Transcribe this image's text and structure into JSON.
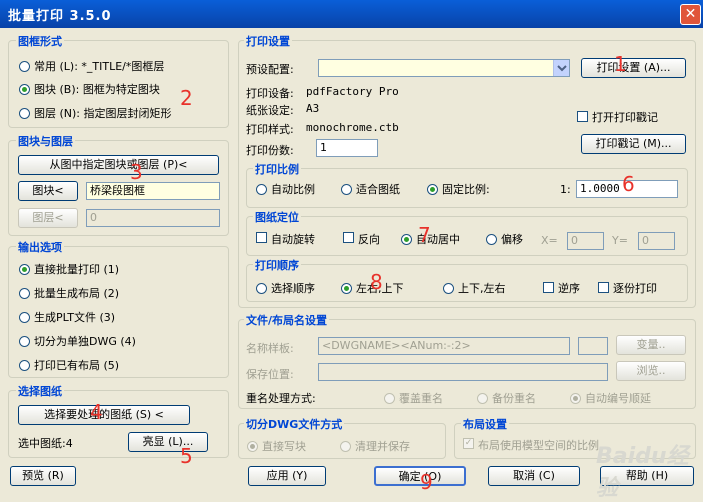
{
  "window": {
    "title": "批量打印 3.5.0",
    "close": "✕"
  },
  "frame_style": {
    "title": "图框形式",
    "options": [
      "常用 (L): *_TITLE/*图框层",
      "图块 (B): 图框为特定图块",
      "图层 (N): 指定图层封闭矩形"
    ],
    "selected": 1
  },
  "block_layer": {
    "title": "图块与图层",
    "pick_button": "从图中指定图块或图层 (P)<",
    "block_button": "图块<",
    "block_value": "桥梁段图框",
    "layer_button": "图层<",
    "layer_value": "0"
  },
  "output": {
    "title": "输出选项",
    "options": [
      "直接批量打印 (1)",
      "批量生成布局 (2)",
      "生成PLT文件 (3)",
      "切分为单独DWG (4)",
      "打印已有布局 (5)"
    ],
    "selected": 0
  },
  "select": {
    "title": "选择图纸",
    "select_button": "选择要处理的图纸 (S) <",
    "count_label": "选中图纸:4",
    "highlight_button": "亮显 (L)..."
  },
  "preview_button": "预览 (R)",
  "print_settings": {
    "title": "打印设置",
    "preset_label": "预设配置:",
    "preset_value": "",
    "settings_button": "打印设置 (A)...",
    "device_label": "打印设备:",
    "device_value": "pdfFactory Pro",
    "paper_label": "纸张设定:",
    "paper_value": "A3",
    "style_label": "打印样式:",
    "style_value": "monochrome.ctb",
    "copies_label": "打印份数:",
    "copies_value": "1",
    "stamp_check": "打开打印戳记",
    "stamp_button": "打印戳记 (M)..."
  },
  "scale": {
    "title": "打印比例",
    "options": [
      "自动比例",
      "适合图纸",
      "固定比例:"
    ],
    "selected": 2,
    "ratio_label": "1:",
    "ratio_value": "1.0000"
  },
  "position": {
    "title": "图纸定位",
    "checks": [
      "自动旋转",
      "反向"
    ],
    "options": [
      "自动居中",
      "偏移"
    ],
    "selected": 0,
    "x_label": "X=",
    "x_value": "0",
    "y_label": "Y=",
    "y_value": "0"
  },
  "order": {
    "title": "打印顺序",
    "options": [
      "选择顺序",
      "左右,上下",
      "上下,左右"
    ],
    "selected": 1,
    "checks": [
      "逆序",
      "逐份打印"
    ]
  },
  "naming": {
    "title": "文件/布局名设置",
    "template_label": "名称样板:",
    "template_value": "<DWGNAME><ANum:-:2>",
    "vars_button": "变量..",
    "save_label": "保存位置:",
    "browse_button": "浏览..",
    "rename_label": "重名处理方式:",
    "rename_options": [
      "覆盖重名",
      "备份重名",
      "自动编号顺延"
    ],
    "rename_selected": 2
  },
  "split": {
    "title": "切分DWG文件方式",
    "options": [
      "直接写块",
      "清理并保存"
    ],
    "selected": 0
  },
  "layout": {
    "title": "布局设置",
    "check": "布局使用模型空间的比例"
  },
  "bottom": {
    "apply": "应用 (Y)",
    "ok": "确定 (O)",
    "cancel": "取消 (C)",
    "help": "帮助 (H)"
  },
  "annotations": [
    "1",
    "2",
    "3",
    "4",
    "5",
    "6",
    "7",
    "8",
    "9"
  ],
  "watermark": "Baidu经验"
}
